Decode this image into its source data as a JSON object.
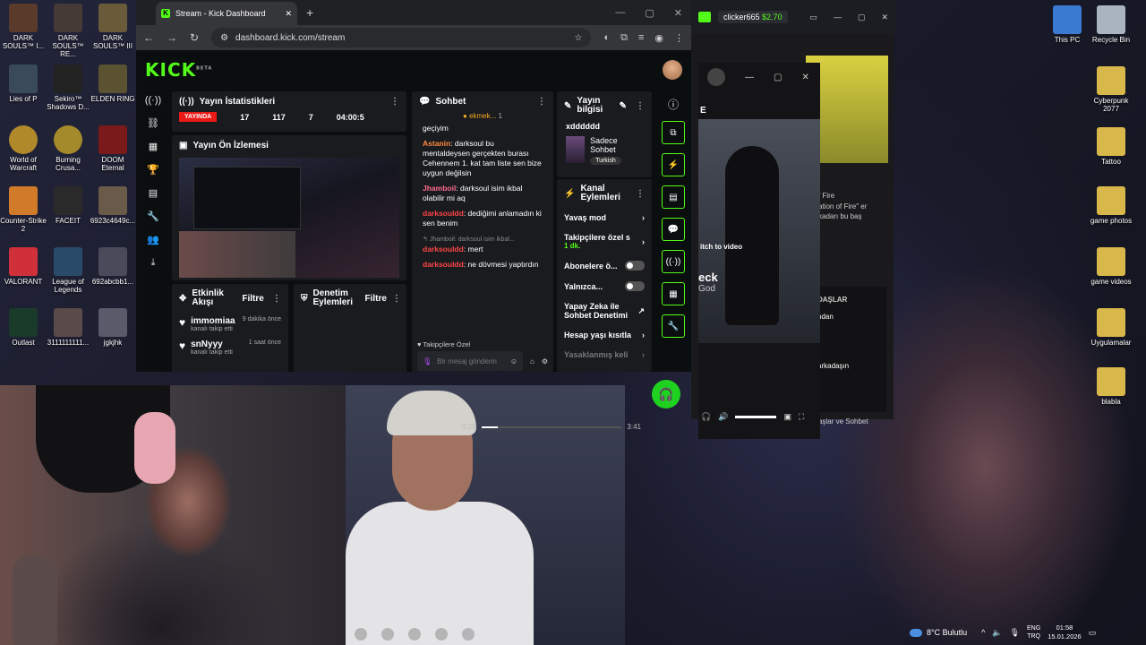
{
  "browser": {
    "tab_title": "Stream - Kick Dashboard",
    "url": "dashboard.kick.com/stream"
  },
  "kick": {
    "logo": "KICK",
    "logo_badge": "BETA",
    "stats": {
      "title": "Yayın İstatistikleri",
      "live": "YAYINDA",
      "viewers": "17",
      "followers": "117",
      "subs": "7",
      "time": "04:00:5"
    },
    "preview": {
      "title": "Yayın Ön İzlemesi"
    },
    "activity": {
      "title": "Etkinlik Akışı",
      "filter": "Filtre",
      "items": [
        {
          "name": "immomiaa",
          "sub": "kanalı takip etti",
          "time": "9 dakika önce"
        },
        {
          "name": "snNyyy",
          "sub": "kanalı takip etti",
          "time": "1 saat önce"
        }
      ]
    },
    "mod": {
      "title": "Denetim Eylemleri",
      "filter": "Filtre"
    },
    "chat": {
      "title": "Sohbet",
      "pinned": "ekmek...",
      "pinned_count": "1",
      "messages": [
        {
          "user": "",
          "text": "geçiyim"
        },
        {
          "user": "Astanin",
          "text": "darksoul bu mentaldeysen gerçekten burası Cehennem 1. kat tam liste sen bize uygun değilsin"
        },
        {
          "user": "Jhamboil",
          "text": "darksoul isim ikbal olabilir mi aq"
        },
        {
          "user": "darksouldd",
          "text": "dediğimi anlamadın ki sen benim"
        },
        {
          "user": "darksouldd",
          "text": "mert",
          "reply": "Jhamboil: darksoul isim ikbal..."
        },
        {
          "user": "darksouldd",
          "text": "ne dövmesi yaptırdın"
        }
      ],
      "footer": "Takipçilere Özel",
      "input_placeholder": "Bir mesaj gönderin"
    },
    "info": {
      "title": "Yayın bilgisi",
      "stream_title": "xdddddd",
      "category": "Sadece Sohbet",
      "tag": "Turkish"
    },
    "actions": {
      "title": "Kanal Eylemleri",
      "rows": [
        {
          "label": "Yavaş mod",
          "kind": "chevron"
        },
        {
          "label": "Takipçilere özel s",
          "sub": "1 dk.",
          "kind": "chevron"
        },
        {
          "label": "Abonelere ö...",
          "kind": "toggle"
        },
        {
          "label": "Yalnızca...",
          "kind": "toggle"
        },
        {
          "label": "Yapay Zeka ile Sohbet Denetimi",
          "kind": "external"
        },
        {
          "label": "Hesap yaşı kısıtla",
          "kind": "chevron"
        },
        {
          "label": "Yasaklanmış keli",
          "kind": "chevron"
        }
      ]
    }
  },
  "win2": {
    "user": "clicker665",
    "price": "$2.70",
    "overlay_title_fragment": "E",
    "side_texts": [
      "f Fire",
      "ation of Fire\" er",
      "kadarı bu baş",
      "DAŞLAR",
      "ndan",
      "arkadaşın",
      "aşlar ve Sohbet"
    ],
    "switch_video": "itch to video",
    "song": "eck",
    "artist": "God",
    "time_current": "0:29",
    "time_total": "3:41",
    "progress": 0.12
  },
  "desktop": {
    "icons_left": [
      "DARK SOULS™ I...",
      "DARK SOULS™ RE...",
      "DARK SOULS™ III",
      "Lies of P",
      "Sekiro™ Shadows D...",
      "ELDEN RING",
      "World of Warcraft",
      "Burning Crusa...",
      "DOOM Eternal",
      "Counter-Strike 2",
      "FACEIT",
      "6923c4649c...",
      "VALORANT",
      "League of Legends",
      "692abcbb1...",
      "Outlast",
      "3111111111...",
      "jgkjhk"
    ],
    "icons_right": [
      "This PC",
      "Recycle Bin",
      "Cyberpunk 2077",
      "Tattoo",
      "game photos",
      "game videos",
      "Uygulamalar",
      "blabla"
    ]
  },
  "tray": {
    "weather": "8°C Bulutlu",
    "lang_top": "ENG",
    "lang_bottom": "TRQ",
    "time": "01:58",
    "date": "15.01.2026"
  },
  "colors": {
    "kick_green": "#53fc18",
    "live_red": "#e91916"
  }
}
